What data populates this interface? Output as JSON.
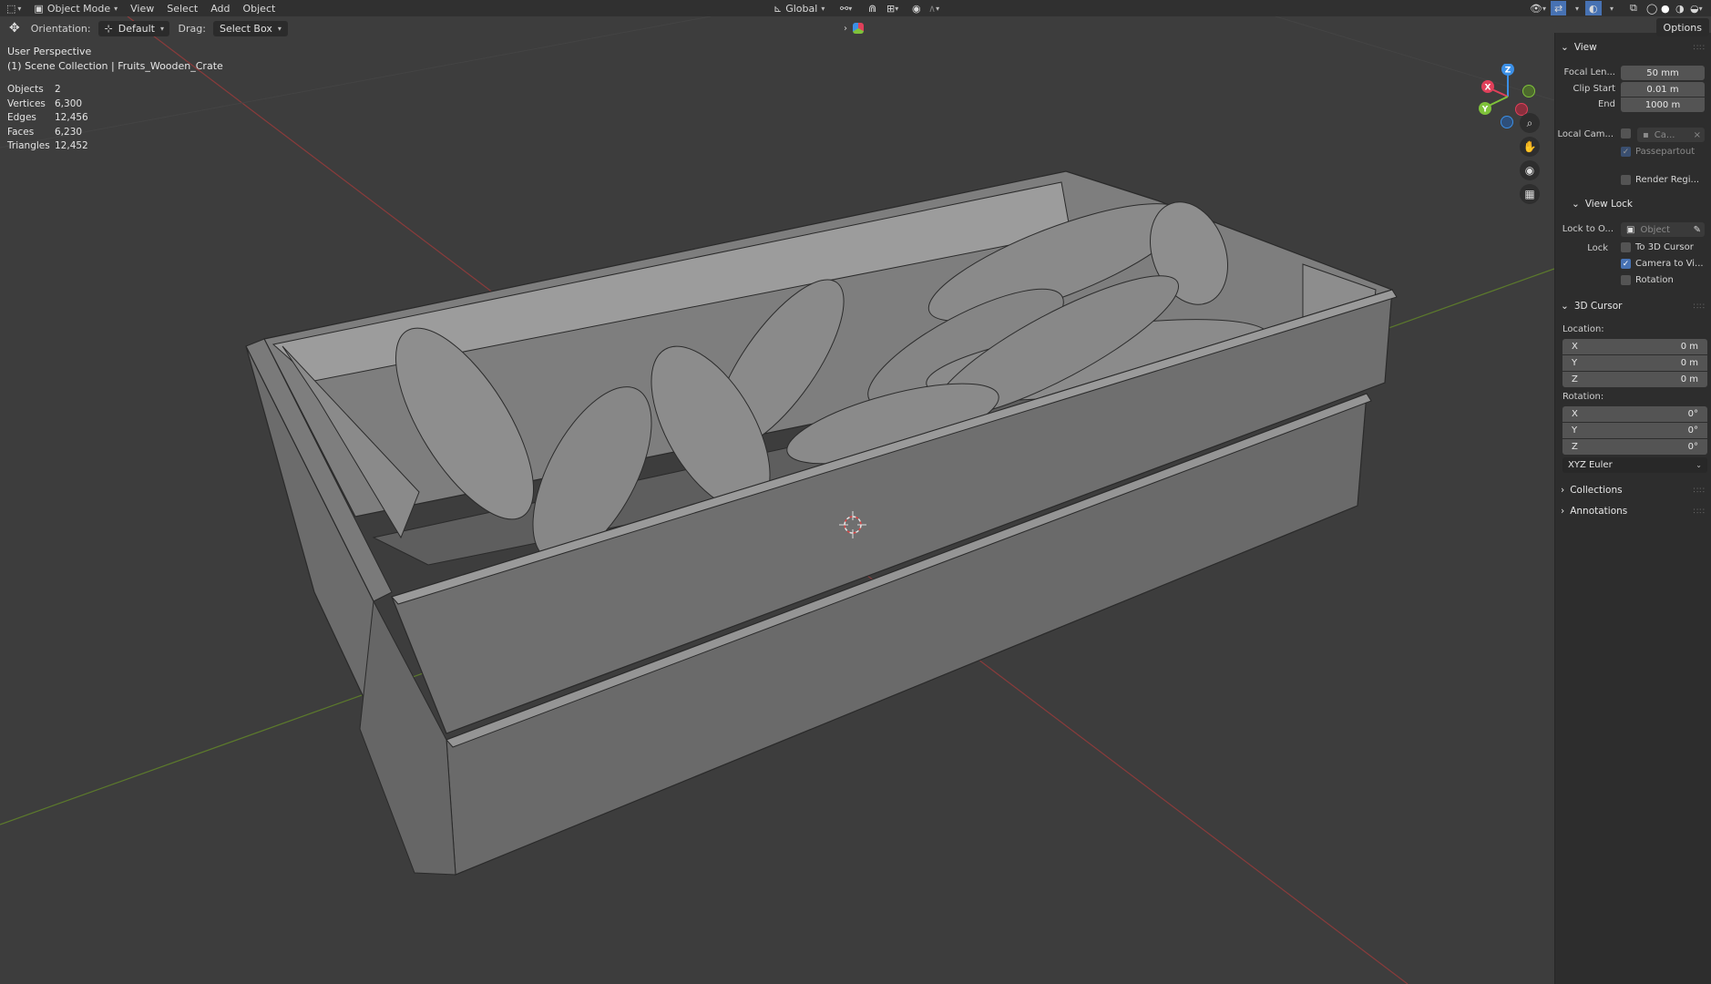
{
  "header": {
    "mode": "Object Mode",
    "menus": [
      "View",
      "Select",
      "Add",
      "Object"
    ],
    "orientation_label": "Orientation:",
    "orientation_value": "Default",
    "drag_label": "Drag:",
    "drag_value": "Select Box",
    "transform_space": "Global",
    "options": "Options"
  },
  "viewport": {
    "perspective": "User Perspective",
    "collection": "(1) Scene Collection | Fruits_Wooden_Crate",
    "stats": [
      {
        "k": "Objects",
        "v": "2"
      },
      {
        "k": "Vertices",
        "v": "6,300"
      },
      {
        "k": "Edges",
        "v": "12,456"
      },
      {
        "k": "Faces",
        "v": "6,230"
      },
      {
        "k": "Triangles",
        "v": "12,452"
      }
    ],
    "gizmo": {
      "x": "X",
      "y": "Y",
      "z": "Z",
      "x_color": "#e0405a",
      "y_color": "#7fc23a",
      "z_color": "#3b8fe6"
    }
  },
  "npanel": {
    "view_title": "View",
    "focal_label": "Focal Len...",
    "focal_value": "50 mm",
    "clip_start_label": "Clip Start",
    "clip_start_value": "0.01 m",
    "end_label": "End",
    "end_value": "1000 m",
    "local_cam_label": "Local Cam...",
    "local_cam_value": "Ca...",
    "passepartout": "Passepartout",
    "render_region": "Render Regi...",
    "view_lock_title": "View Lock",
    "lock_to_label": "Lock to O...",
    "lock_to_value": "Object",
    "lock_label": "Lock",
    "to_3d_cursor": "To 3D Cursor",
    "camera_to_view": "Camera to Vi...",
    "rotation_lock": "Rotation",
    "cursor_title": "3D Cursor",
    "location_label": "Location:",
    "location": [
      {
        "axis": "X",
        "value": "0 m"
      },
      {
        "axis": "Y",
        "value": "0 m"
      },
      {
        "axis": "Z",
        "value": "0 m"
      }
    ],
    "rotation_label": "Rotation:",
    "rotation": [
      {
        "axis": "X",
        "value": "0°"
      },
      {
        "axis": "Y",
        "value": "0°"
      },
      {
        "axis": "Z",
        "value": "0°"
      }
    ],
    "rotation_mode": "XYZ Euler",
    "collections": "Collections",
    "annotations": "Annotations"
  }
}
